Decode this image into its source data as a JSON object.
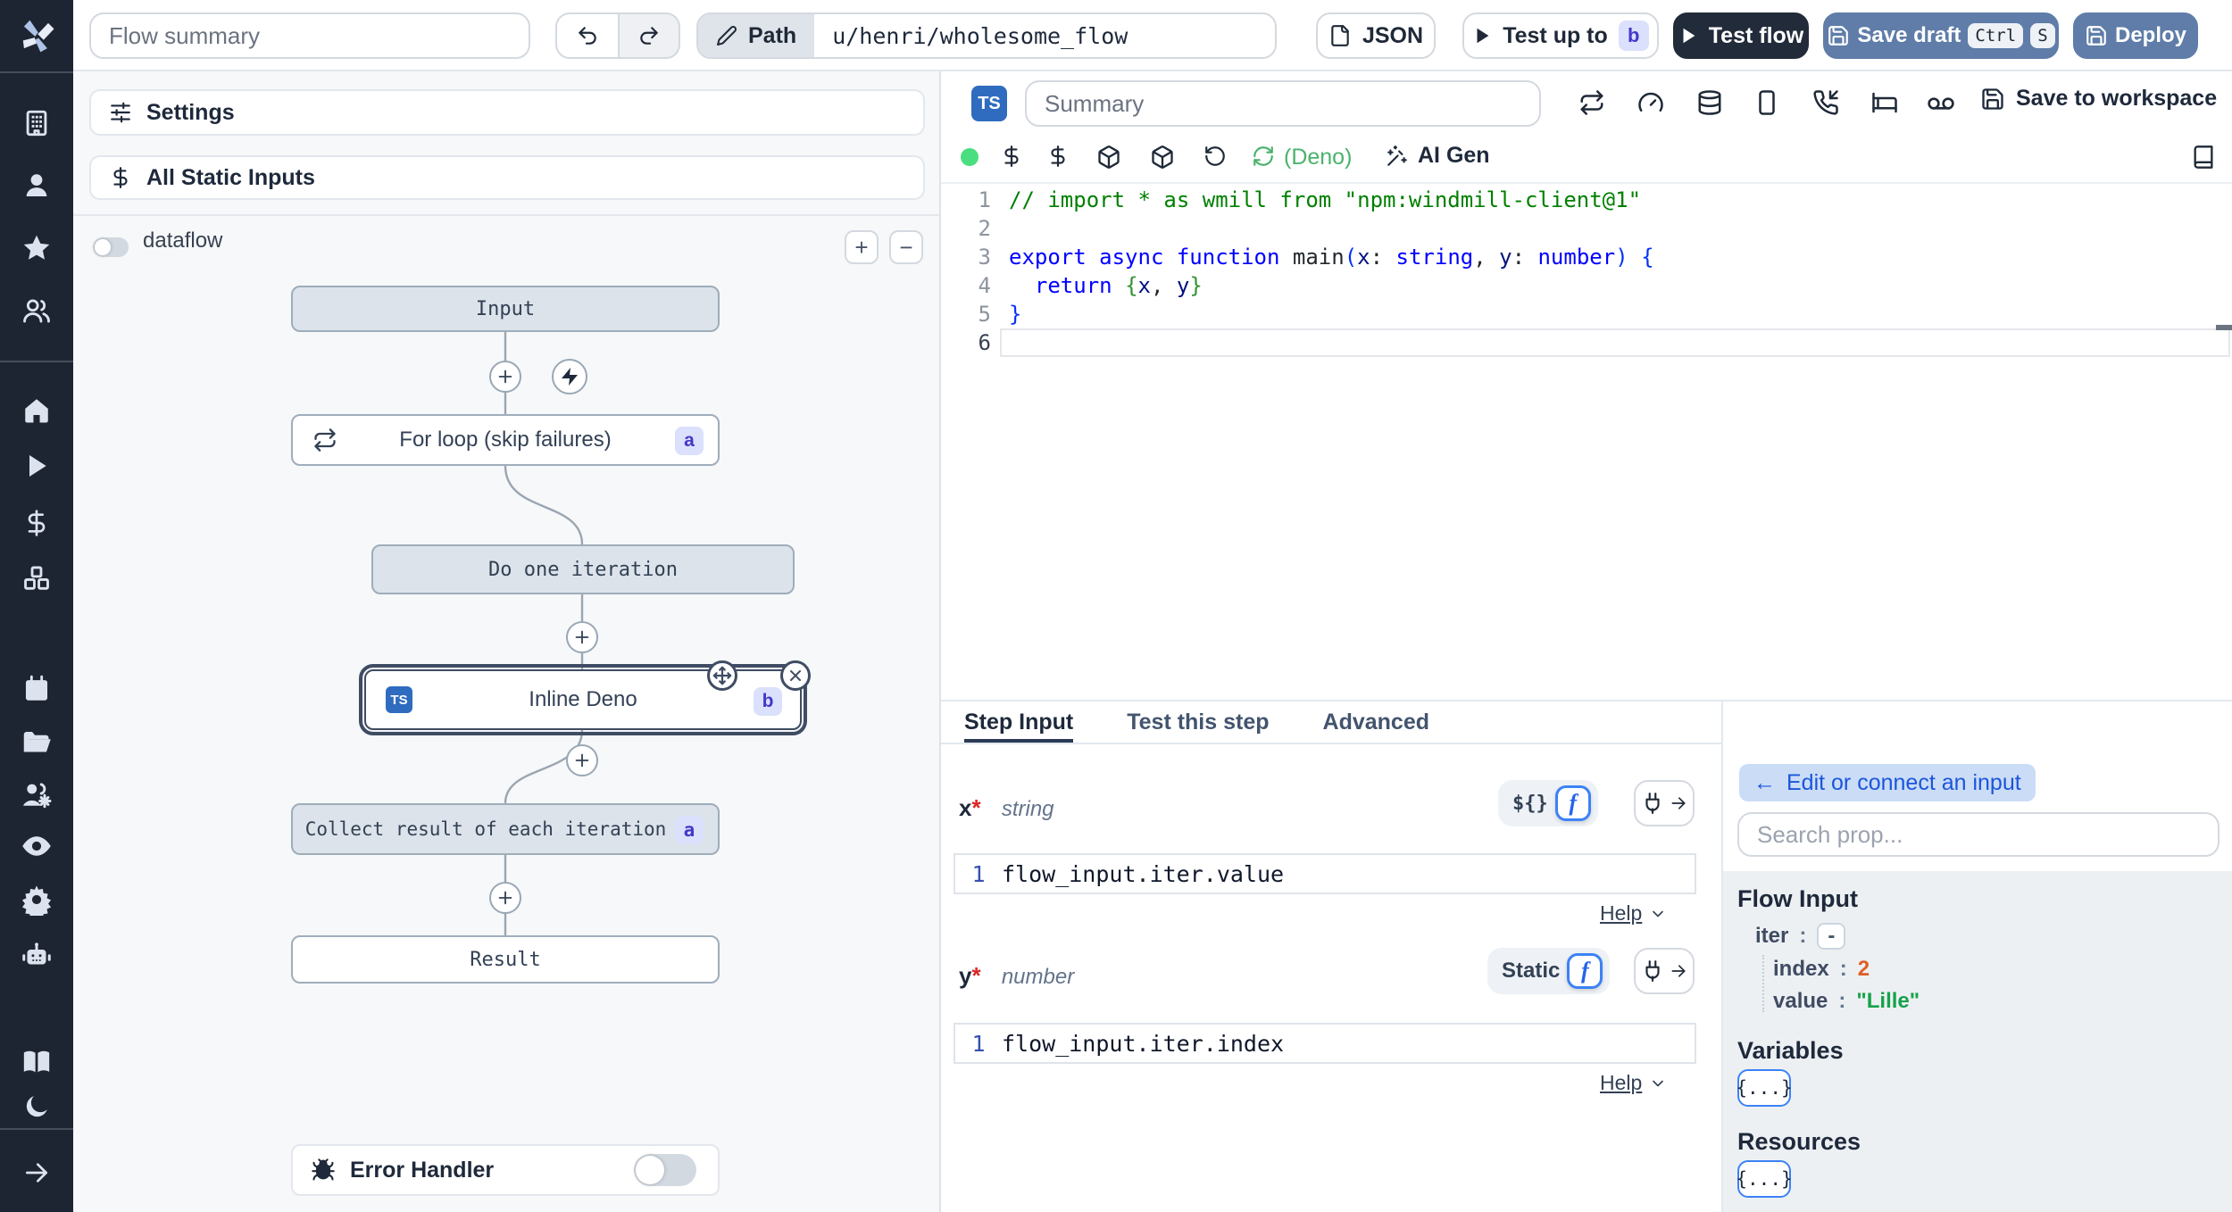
{
  "topbar": {
    "flow_summary": "Flow summary",
    "path_label": "Path",
    "path_value": "u/henri/wholesome_flow",
    "json": "JSON",
    "test_up_to": "Test up to",
    "test_up_to_badge": "b",
    "test_flow": "Test flow",
    "save_draft": "Save draft",
    "kbd": [
      "Ctrl",
      "S"
    ],
    "deploy": "Deploy"
  },
  "flow": {
    "settings": "Settings",
    "static_inputs": "All Static Inputs",
    "dataflow": "dataflow",
    "zoom_in": "+",
    "zoom_out": "−",
    "nodes": {
      "input": "Input",
      "forloop": "For loop (skip failures)",
      "forloop_badge": "a",
      "doone": "Do one iteration",
      "inline": "Inline Deno",
      "inline_badge": "b",
      "inline_lang": "TS",
      "collect": "Collect result of each iteration",
      "collect_badge": "a",
      "result": "Result",
      "error_handler": "Error Handler"
    }
  },
  "editor": {
    "lang_badge": "TS",
    "summary_placeholder": "Summary",
    "deno": "(Deno)",
    "ai_gen": "AI Gen",
    "save_to_workspace": "Save to workspace",
    "line_numbers": [
      "1",
      "2",
      "3",
      "4",
      "5",
      "6"
    ],
    "code_lines": [
      [
        [
          "// import * as wmill from \"npm:windmill-client@1\"",
          "cm"
        ]
      ],
      [],
      [
        [
          "export",
          "kw"
        ],
        [
          " ",
          "pl"
        ],
        [
          "async",
          "kw"
        ],
        [
          " ",
          "pl"
        ],
        [
          "function",
          "kw"
        ],
        [
          " ",
          "pl"
        ],
        [
          "main",
          "fn"
        ],
        [
          "(",
          "b1"
        ],
        [
          "x",
          "id"
        ],
        [
          ":",
          "pl"
        ],
        [
          " ",
          "pl"
        ],
        [
          "string",
          "kw"
        ],
        [
          ",",
          "pl"
        ],
        [
          " ",
          "pl"
        ],
        [
          "y",
          "id"
        ],
        [
          ":",
          "pl"
        ],
        [
          " ",
          "pl"
        ],
        [
          "number",
          "kw"
        ],
        [
          ")",
          "b1"
        ],
        [
          " ",
          "pl"
        ],
        [
          "{",
          "b1"
        ]
      ],
      [
        [
          "  ",
          "pl"
        ],
        [
          "return",
          "kw"
        ],
        [
          " ",
          "pl"
        ],
        [
          "{",
          "b2"
        ],
        [
          "x",
          "id"
        ],
        [
          ",",
          "pl"
        ],
        [
          " ",
          "pl"
        ],
        [
          "y",
          "id"
        ],
        [
          "}",
          "b2"
        ]
      ],
      [
        [
          "}",
          "b1"
        ]
      ],
      []
    ]
  },
  "step": {
    "tabs": [
      "Step Input",
      "Test this step",
      "Advanced"
    ],
    "x_name": "x",
    "x_req": "*",
    "x_type": "string",
    "y_name": "y",
    "y_req": "*",
    "y_type": "number",
    "dollar_brace": "${}",
    "f_icon": "f",
    "static_label": "Static",
    "help": "Help",
    "x_value": "flow_input.iter.value",
    "y_value": "flow_input.iter.index",
    "line_no": "1"
  },
  "prop": {
    "edit_button": "Edit or connect an input",
    "back_arrow": "←",
    "search_placeholder": "Search prop...",
    "flow_input": "Flow Input",
    "iter": "iter",
    "colon": ":",
    "dash": "-",
    "index": "index",
    "index_value": "2",
    "value": "value",
    "value_value": "\"Lille\"",
    "variables": "Variables",
    "braces": "{...}",
    "resources": "Resources"
  }
}
